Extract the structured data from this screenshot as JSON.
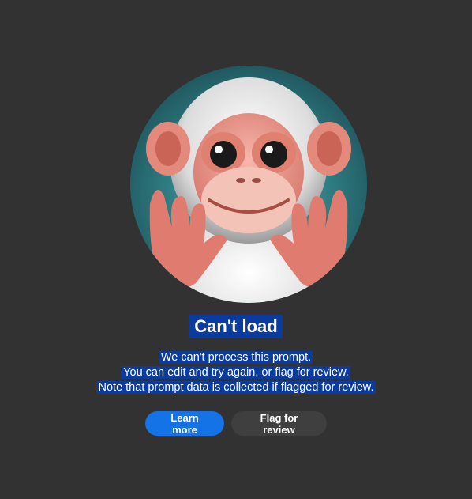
{
  "dialog": {
    "title": "Can't load",
    "message_lines": [
      "We can't process this prompt.",
      "You can edit and try again, or flag for review.",
      "Note that prompt data is collected if flagged for review."
    ],
    "illustration": "monkey-illustration"
  },
  "actions": {
    "learn_more": "Learn more",
    "flag_for_review": "Flag for review"
  },
  "colors": {
    "background": "#323232",
    "primary_button": "#1473e6",
    "secondary_button": "#3f3f3f",
    "selection_highlight": "#0b3b9c"
  }
}
